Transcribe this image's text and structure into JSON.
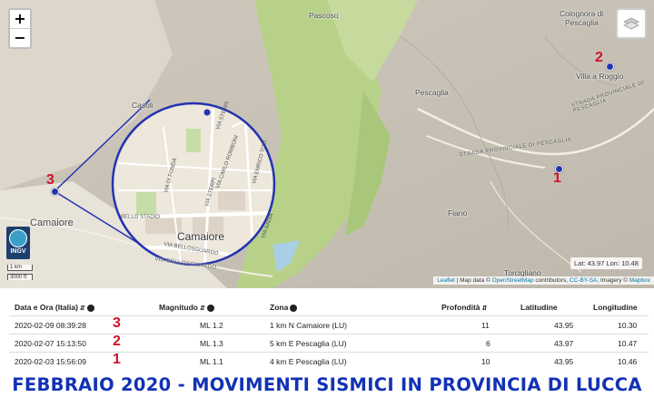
{
  "map": {
    "zoom_in": "+",
    "zoom_out": "−",
    "layers_icon": "layers-icon",
    "places": {
      "pascoso": "Pascoso",
      "colognora": "Colognora di",
      "colognora2": "Pescaglia",
      "villa_roggio": "Villa a Roggio",
      "pescaglia": "Pescaglia",
      "casoli": "Casoli",
      "camaiore": "Camaiore",
      "fiano": "Fiano",
      "torcigliano": "Torcigliano"
    },
    "roads": {
      "strada_prov": "STRADA PROVINCIALE DI PESCAGLIA",
      "strada_prov2": "STRADA PROVINCIALE DI PESCAGLIA",
      "via_bellosguardo": "VIA BELLOSGUARDO"
    },
    "lens": {
      "town": "Camaiore",
      "streets": [
        "VIA STERPI",
        "VIA CARLO ROMBONI",
        "VIA ENRICO TOTI",
        "VIA DI FONDA",
        "VIA STERPI",
        "VIA BADIA",
        "BELLO STADIO",
        "VIA BELLOSGUARDO"
      ]
    },
    "markers": [
      {
        "number": "1"
      },
      {
        "number": "2"
      },
      {
        "number": "3"
      }
    ],
    "logo": "INGV",
    "scale_km": "1 km",
    "scale_ft": "3000 ft",
    "coords": "Lat: 43.97 Lon: 10.48",
    "attribution": {
      "leaflet": "Leaflet",
      "mid": " | Map data © ",
      "osm": "OpenStreetMap",
      "mid2": " contributors, ",
      "ccbysa": "CC-BY-SA",
      "mid3": ", Imagery © ",
      "mapbox": "Mapbox"
    }
  },
  "table": {
    "headers": {
      "date": "Data e Ora (Italia)",
      "magnitude": "Magnitudo",
      "zone": "Zona",
      "depth": "Profondità",
      "lat": "Latitudine",
      "lon": "Longitudine"
    },
    "rows": [
      {
        "marker": "3",
        "date": "2020-02-09 08:39:28",
        "magnitude": "ML 1.2",
        "zone": "1 km N Camaiore (LU)",
        "depth": "11",
        "lat": "43.95",
        "lon": "10.30"
      },
      {
        "marker": "2",
        "date": "2020-02-07 15:13:50",
        "magnitude": "ML 1.3",
        "zone": "5 km E Pescaglia (LU)",
        "depth": "6",
        "lat": "43.97",
        "lon": "10.47"
      },
      {
        "marker": "1",
        "date": "2020-02-03 15:56:09",
        "magnitude": "ML 1.1",
        "zone": "4 km E Pescaglia (LU)",
        "depth": "10",
        "lat": "43.95",
        "lon": "10.46"
      }
    ]
  },
  "banner": "FEBBRAIO 2020 - MOVIMENTI SISMICI IN PROVINCIA DI LUCCA",
  "colors": {
    "marker_red": "#d0112b",
    "pin_blue": "#2433b0",
    "banner_blue": "#1232b5"
  }
}
